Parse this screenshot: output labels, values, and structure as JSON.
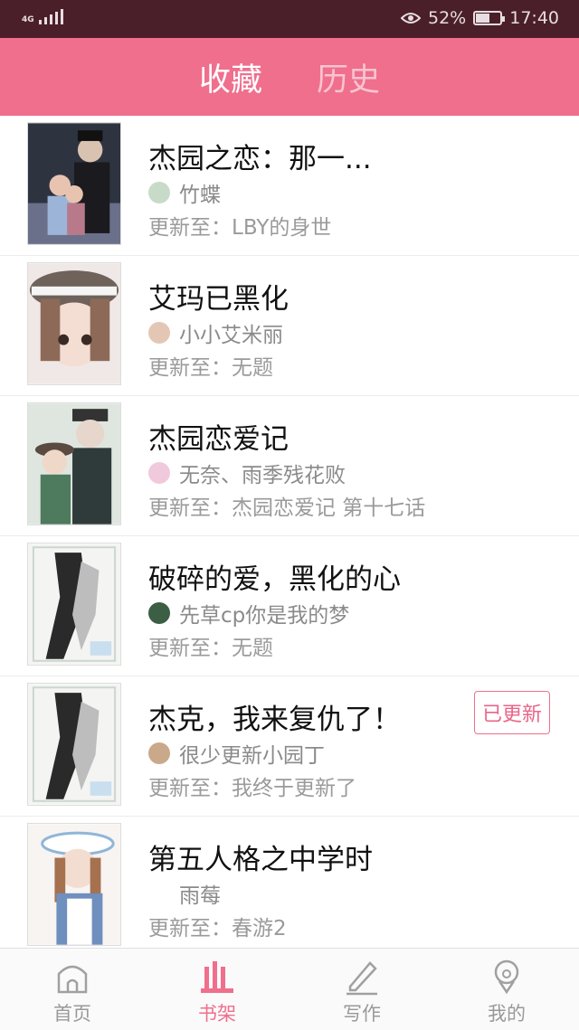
{
  "status": {
    "network": "4G",
    "battery_pct": "52%",
    "time": "17:40"
  },
  "tabs": [
    {
      "label": "收藏",
      "active": true
    },
    {
      "label": "历史",
      "active": false
    }
  ],
  "items": [
    {
      "title": "杰园之恋：那一...",
      "author": "竹蝶",
      "update": "更新至：LBY的身世",
      "badge": ""
    },
    {
      "title": "艾玛已黑化",
      "author": "小小艾米丽",
      "update": "更新至：无题",
      "badge": ""
    },
    {
      "title": "杰园恋爱记",
      "author": "无奈、雨季残花败",
      "update": "更新至：杰园恋爱记 第十七话",
      "badge": ""
    },
    {
      "title": "破碎的爱，黑化的心",
      "author": "先草cp你是我的梦",
      "update": "更新至：无题",
      "badge": ""
    },
    {
      "title": "杰克，我来复仇了！",
      "author": "很少更新小园丁",
      "update": "更新至：我终于更新了",
      "badge": "已更新"
    },
    {
      "title": "第五人格之中学时",
      "author": "雨莓",
      "update": "更新至：春游2",
      "badge": ""
    }
  ],
  "nav": [
    {
      "label": "首页",
      "icon": "home-icon"
    },
    {
      "label": "书架",
      "icon": "bookshelf-icon",
      "active": true
    },
    {
      "label": "写作",
      "icon": "pen-icon"
    },
    {
      "label": "我的",
      "icon": "profile-icon"
    }
  ]
}
